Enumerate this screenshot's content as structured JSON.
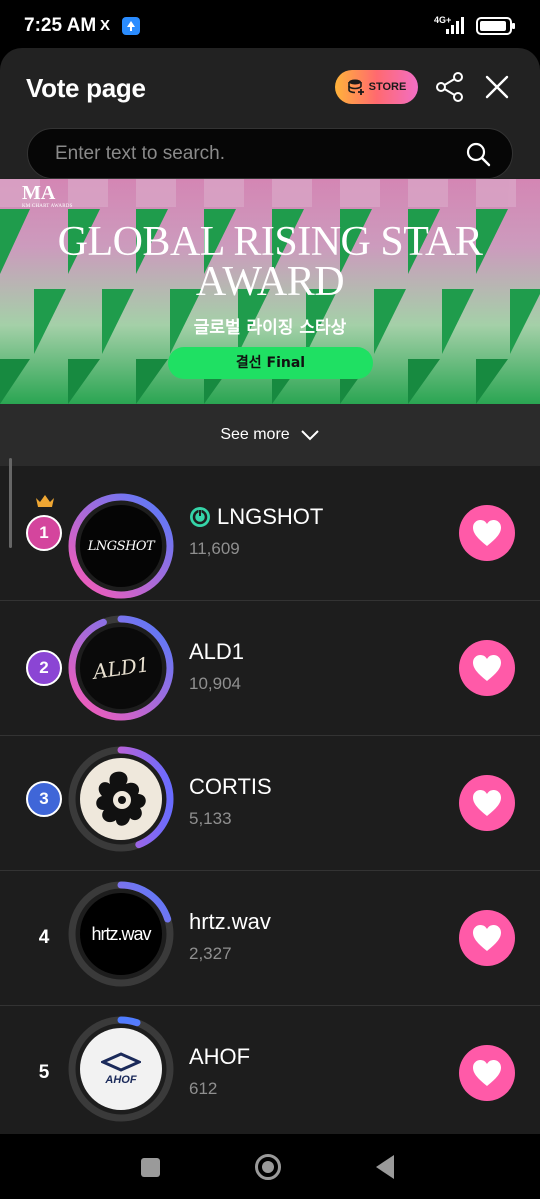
{
  "status_bar": {
    "time": "7:25 AM",
    "x_icon": "X",
    "network": "4G+"
  },
  "header": {
    "title": "Vote page",
    "store_label": "STORE",
    "share_icon": "share-icon",
    "close_icon": "close-icon"
  },
  "search": {
    "placeholder": "Enter text to search.",
    "value": ""
  },
  "banner": {
    "logo_text": "MA",
    "logo_sub": "KM CHART AWARDS",
    "title_line1": "GLOBAL RISING STAR",
    "title_line2": "AWARD",
    "korean_title": "글로벌 라이징 스타상",
    "final_label": "결선 Final",
    "colors": {
      "pink": "#d486b4",
      "green": "#2aa552",
      "pill": "#1fe063"
    }
  },
  "see_more": {
    "label": "See more"
  },
  "ranking": [
    {
      "rank": "1",
      "name": "LNGSHOT",
      "votes": "11,609",
      "verified": true,
      "badge_color": "#d4459d",
      "ring_fraction": 1.0,
      "avatar_text": "LNGSHOT"
    },
    {
      "rank": "2",
      "name": "ALD1",
      "votes": "10,904",
      "verified": false,
      "badge_color": "#8b45d4",
      "ring_fraction": 0.94,
      "avatar_text": "ALD1"
    },
    {
      "rank": "3",
      "name": "CORTIS",
      "votes": "5,133",
      "verified": false,
      "badge_color": "#3f66d8",
      "ring_fraction": 0.44,
      "avatar_text": ""
    },
    {
      "rank": "4",
      "name": "hrtz.wav",
      "votes": "2,327",
      "verified": false,
      "badge_color": "",
      "ring_fraction": 0.2,
      "avatar_text": "hrtz.wav"
    },
    {
      "rank": "5",
      "name": "AHOF",
      "votes": "612",
      "verified": false,
      "badge_color": "",
      "ring_fraction": 0.053,
      "avatar_text": "AHOF"
    }
  ],
  "colors": {
    "accent_heart": "#ff5aa8",
    "ring_gradient_start": "#ff59b4",
    "ring_gradient_end": "#4f7cff",
    "store_gradient": [
      "#ffb33a",
      "#ff6a6f",
      "#f26ec5"
    ]
  }
}
